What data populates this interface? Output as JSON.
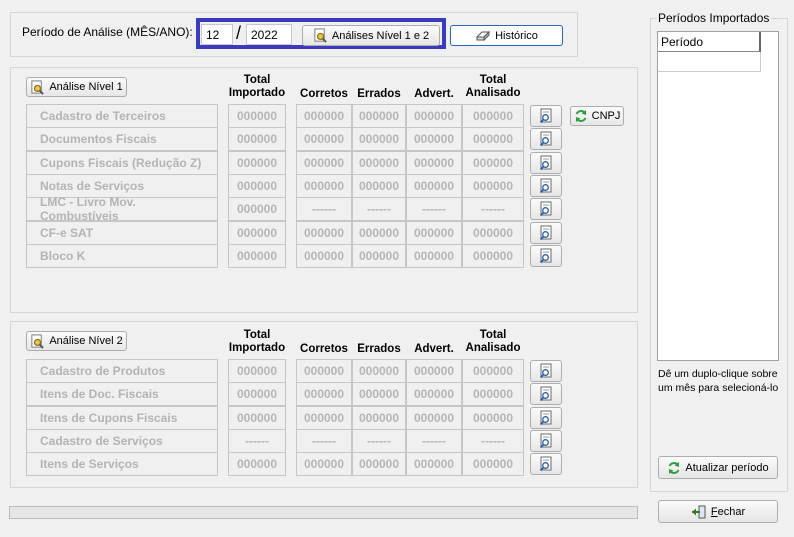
{
  "period": {
    "label": "Período de Análise (MÊS/ANO):",
    "month": "12",
    "separator": "/",
    "year": "2022",
    "analyses_button": "Análises Nível 1 e 2",
    "history_button": "Histórico"
  },
  "columns": {
    "total_importado": [
      "Total",
      "Importado"
    ],
    "corretos": "Corretos",
    "errados": "Errados",
    "advert": "Advert.",
    "total_analisado": [
      "Total",
      "Analisado"
    ]
  },
  "level1": {
    "button": "Análise Nível 1",
    "cnpj_button": "CNPJ",
    "rows": [
      {
        "label": "Cadastro de Terceiros",
        "values": [
          "000000",
          "000000",
          "000000",
          "000000",
          "000000"
        ]
      },
      {
        "label": "Documentos Fiscais",
        "values": [
          "000000",
          "000000",
          "000000",
          "000000",
          "000000"
        ]
      },
      {
        "label": "Cupons Fiscais (Redução Z)",
        "values": [
          "000000",
          "000000",
          "000000",
          "000000",
          "000000"
        ]
      },
      {
        "label": "Notas de Serviços",
        "values": [
          "000000",
          "000000",
          "000000",
          "000000",
          "000000"
        ]
      },
      {
        "label": "LMC - Livro Mov. Combustíveis",
        "values": [
          "000000",
          "------",
          "------",
          "------",
          "------"
        ]
      },
      {
        "label": "CF-e SAT",
        "values": [
          "000000",
          "000000",
          "000000",
          "000000",
          "000000"
        ]
      },
      {
        "label": "Bloco K",
        "values": [
          "000000",
          "000000",
          "000000",
          "000000",
          "000000"
        ]
      }
    ]
  },
  "level2": {
    "button": "Análise Nível 2",
    "rows": [
      {
        "label": "Cadastro de Produtos",
        "values": [
          "000000",
          "000000",
          "000000",
          "000000",
          "000000"
        ]
      },
      {
        "label": "Itens de Doc. Fiscais",
        "values": [
          "000000",
          "000000",
          "000000",
          "000000",
          "000000"
        ]
      },
      {
        "label": "Itens de Cupons Fiscais",
        "values": [
          "000000",
          "000000",
          "000000",
          "000000",
          "000000"
        ]
      },
      {
        "label": "Cadastro de Serviços",
        "values": [
          "------",
          "------",
          "------",
          "------",
          "------"
        ]
      },
      {
        "label": "Itens de Serviços",
        "values": [
          "000000",
          "000000",
          "000000",
          "000000",
          "000000"
        ]
      }
    ]
  },
  "imported": {
    "title": "Períodos Importados",
    "column": "Período",
    "hint_line1": "Dê um duplo-clique sobre",
    "hint_line2": "um mês para selecioná-lo",
    "refresh_button": "Atualizar período"
  },
  "close_button_prefix": "F",
  "close_button_rest": "echar",
  "colors": {
    "highlight_border": "#3b3bbf",
    "refresh_green": "#2e9e3e"
  }
}
